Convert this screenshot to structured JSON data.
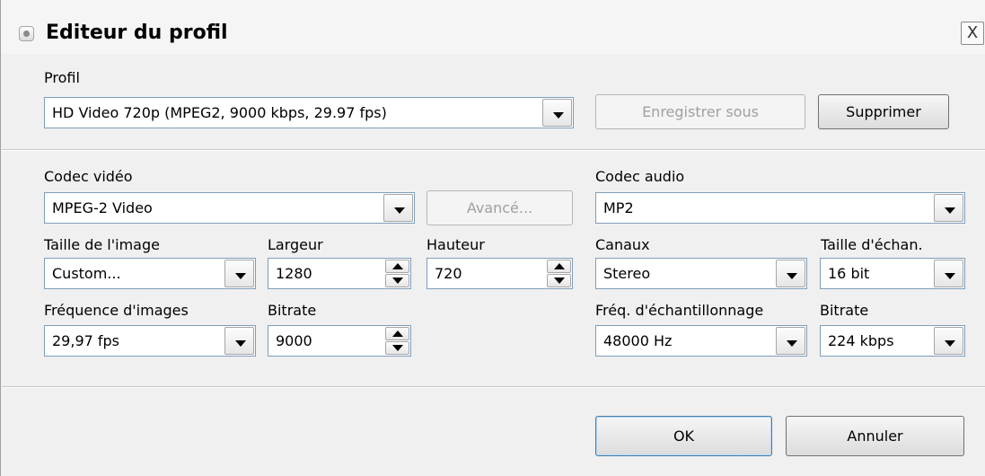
{
  "dialog": {
    "title": "Editeur du profil",
    "close_glyph": "X"
  },
  "profile": {
    "label": "Profil",
    "value": "HD Video 720p (MPEG2, 9000 kbps, 29.97 fps)",
    "save_as_label": "Enregistrer sous",
    "delete_label": "Supprimer"
  },
  "video": {
    "codec_label": "Codec vidéo",
    "codec_value": "MPEG-2 Video",
    "advanced_label": "Avancé...",
    "size_label": "Taille de l'image",
    "size_value": "Custom...",
    "width_label": "Largeur",
    "width_value": "1280",
    "height_label": "Hauteur",
    "height_value": "720",
    "framerate_label": "Fréquence d'images",
    "framerate_value": "29,97 fps",
    "bitrate_label": "Bitrate",
    "bitrate_value": "9000"
  },
  "audio": {
    "codec_label": "Codec audio",
    "codec_value": "MP2",
    "channels_label": "Canaux",
    "channels_value": "Stereo",
    "sample_size_label": "Taille d'échan.",
    "sample_size_value": "16 bit",
    "sample_rate_label": "Fréq. d'échantillonnage",
    "sample_rate_value": "48000 Hz",
    "bitrate_label": "Bitrate",
    "bitrate_value": "224 kbps"
  },
  "footer": {
    "ok_label": "OK",
    "cancel_label": "Annuler"
  },
  "colors": {
    "field_border": "#7f9db9",
    "default_button_border": "#3c7fb1",
    "disabled_text": "#a0a0a0"
  }
}
